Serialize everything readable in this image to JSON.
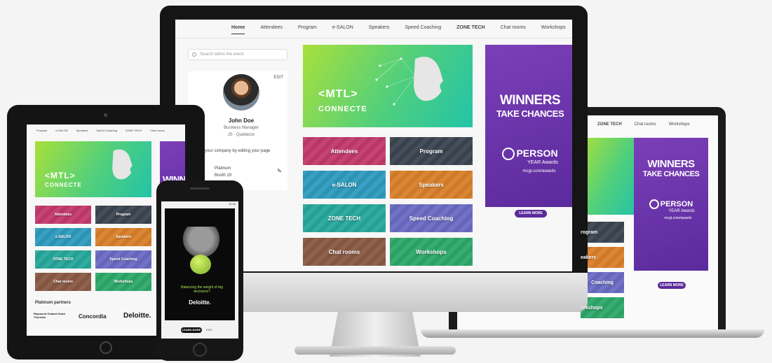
{
  "nav": [
    "Home",
    "Attendees",
    "Program",
    "e-SALON",
    "Speakers",
    "Speed Coaching",
    "ZONE TECH",
    "Chat rooms",
    "Workshops"
  ],
  "laptop_nav": [
    "ZONE TECH",
    "Chat rooms",
    "Workshops"
  ],
  "tablet_nav": [
    "Program",
    "e-SALON",
    "Speakers",
    "Speed Coaching",
    "ZONE TECH",
    "Chat rooms"
  ],
  "search": {
    "placeholder": "Search within the event"
  },
  "profile": {
    "edit": "EDIT",
    "name": "John Doe",
    "title": "Business Manager",
    "company": "JS - Quebecor",
    "note": "your company by editing your page",
    "tier": "Platinum",
    "booth": "Booth 19"
  },
  "hero": {
    "line1": "<MTL>",
    "line2": "CONNECTE"
  },
  "tiles": [
    "Attendees",
    "Program",
    "e-SALON",
    "Speakers",
    "ZONE TECH",
    "Speed Coaching",
    "Chat rooms",
    "Workshops"
  ],
  "ad": {
    "line1": "WINNERS",
    "line2": "TAKE CHANCES",
    "brand": "PERSON",
    "brand_sub": "YEAR Awards",
    "url": "mcgt.com/awards",
    "button": "LEARN MORE"
  },
  "laptop_partial": {
    "tile1": "rogram",
    "tile2": "eakers",
    "tile3": "Coaching",
    "tile4": "orkshops"
  },
  "tablet": {
    "winners_partial": "WINN",
    "partners_title": "Platinum partners",
    "partners": [
      "Raymond Chabot Grant Thornton",
      "Concordia",
      "Deloitte."
    ]
  },
  "phone": {
    "status": "12:30",
    "caption": "Balancing the weight of big decisions?",
    "brand": "Deloitte.",
    "learn": "LEARN MORE",
    "edit": "EDIT"
  },
  "colors": {
    "purple": "#5b2a9c",
    "green": "#4fcf7d",
    "tile_colors": [
      "#c23a6a",
      "#3b4550",
      "#2f9bbf",
      "#d9802a",
      "#27a89c",
      "#6a6cc4",
      "#8a5a45",
      "#2ea86a"
    ]
  }
}
